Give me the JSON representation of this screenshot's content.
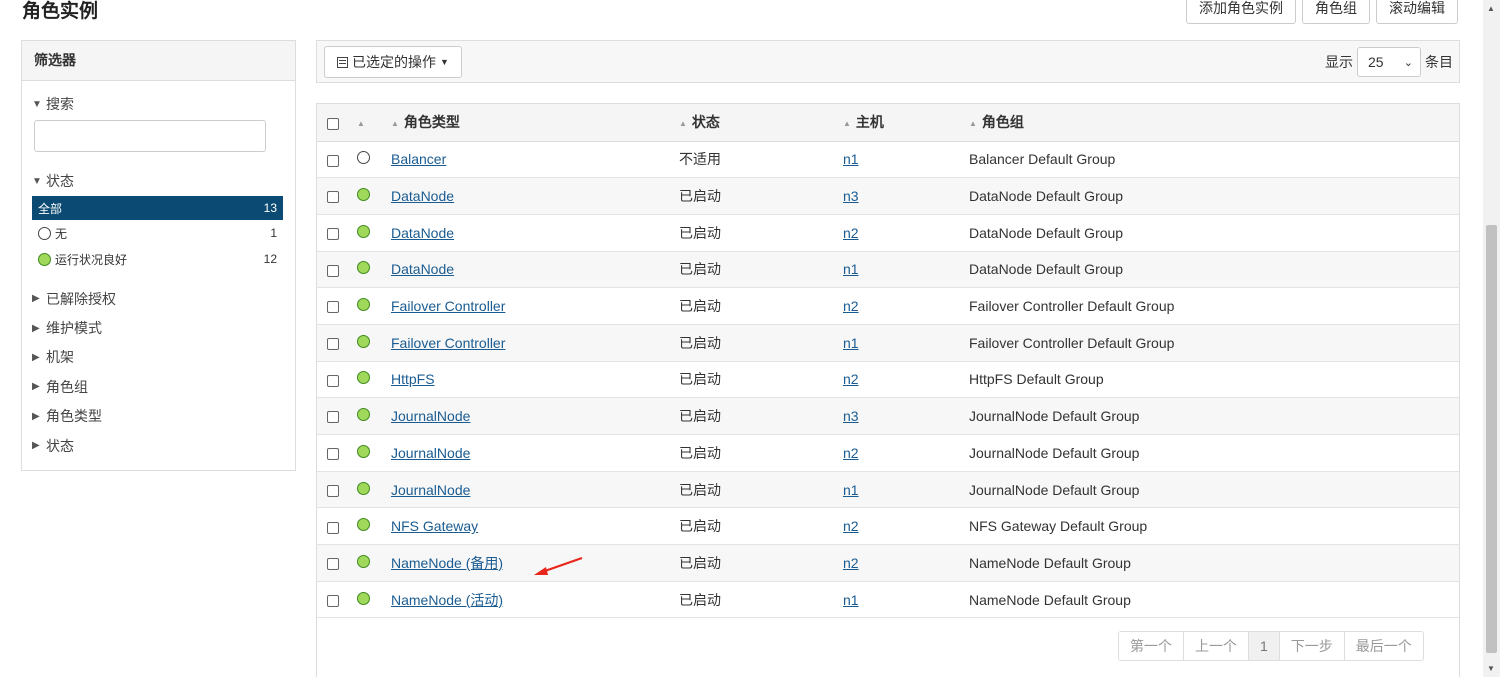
{
  "page": {
    "title": "角色实例"
  },
  "top_actions": {
    "add_instance": "添加角色实例",
    "role_groups": "角色组",
    "rolling_edit": "滚动编辑"
  },
  "filter": {
    "title": "筛选器",
    "search_label": "搜索",
    "status_label": "状态",
    "status_items": [
      {
        "label": "全部",
        "count": "13"
      },
      {
        "label": "无",
        "count": "1"
      },
      {
        "label": "运行状况良好",
        "count": "12"
      }
    ],
    "collapsed": [
      "已解除授权",
      "维护模式",
      "机架",
      "角色组",
      "角色类型",
      "状态"
    ]
  },
  "toolbar": {
    "selected_actions": "已选定的操作",
    "show_label": "显示",
    "page_size": "25",
    "entries_label": "条目"
  },
  "table": {
    "headers": {
      "role_type": "角色类型",
      "state": "状态",
      "host": "主机",
      "role_group": "角色组"
    },
    "rows": [
      {
        "status": "none",
        "role_type": "Balancer",
        "state": "不适用",
        "host": "n1",
        "role_group": "Balancer Default Group"
      },
      {
        "status": "good",
        "role_type": "DataNode",
        "state": "已启动",
        "host": "n3",
        "role_group": "DataNode Default Group"
      },
      {
        "status": "good",
        "role_type": "DataNode",
        "state": "已启动",
        "host": "n2",
        "role_group": "DataNode Default Group"
      },
      {
        "status": "good",
        "role_type": "DataNode",
        "state": "已启动",
        "host": "n1",
        "role_group": "DataNode Default Group"
      },
      {
        "status": "good",
        "role_type": "Failover Controller",
        "state": "已启动",
        "host": "n2",
        "role_group": "Failover Controller Default Group"
      },
      {
        "status": "good",
        "role_type": "Failover Controller",
        "state": "已启动",
        "host": "n1",
        "role_group": "Failover Controller Default Group"
      },
      {
        "status": "good",
        "role_type": "HttpFS",
        "state": "已启动",
        "host": "n2",
        "role_group": "HttpFS Default Group"
      },
      {
        "status": "good",
        "role_type": "JournalNode",
        "state": "已启动",
        "host": "n3",
        "role_group": "JournalNode Default Group"
      },
      {
        "status": "good",
        "role_type": "JournalNode",
        "state": "已启动",
        "host": "n2",
        "role_group": "JournalNode Default Group"
      },
      {
        "status": "good",
        "role_type": "JournalNode",
        "state": "已启动",
        "host": "n1",
        "role_group": "JournalNode Default Group"
      },
      {
        "status": "good",
        "role_type": "NFS Gateway",
        "state": "已启动",
        "host": "n2",
        "role_group": "NFS Gateway Default Group"
      },
      {
        "status": "good",
        "role_type": "NameNode (备用)",
        "state": "已启动",
        "host": "n2",
        "role_group": "NameNode Default Group"
      },
      {
        "status": "good",
        "role_type": "NameNode (活动)",
        "state": "已启动",
        "host": "n1",
        "role_group": "NameNode Default Group"
      }
    ]
  },
  "pagination": {
    "first": "第一个",
    "prev": "上一个",
    "current": "1",
    "next": "下一步",
    "last": "最后一个"
  },
  "colors": {
    "active_filter_bg": "#0b4b73",
    "link": "#1a5c92",
    "health_good": "#9fd85a",
    "annotation_arrow": "#e8261c"
  }
}
